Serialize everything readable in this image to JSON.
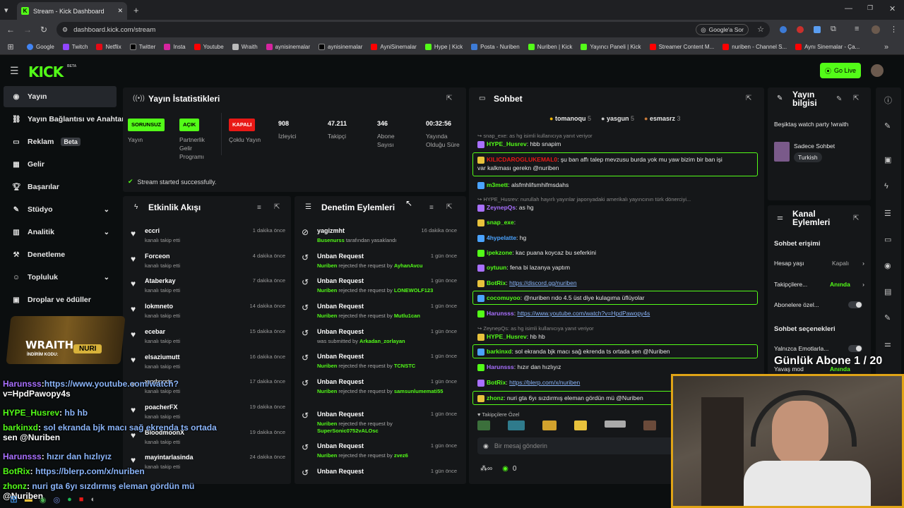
{
  "browser": {
    "tab_title": "Stream - Kick Dashboard",
    "url": "dashboard.kick.com/stream",
    "google_pill": "Google'a Sor",
    "bookmarks": [
      "Google",
      "Twitch",
      "Netflix",
      "Twitter",
      "Insta",
      "Youtube",
      "Wraith",
      "aynisinemalar",
      "aynisinemalar",
      "AyniSinemalar",
      "Hype | Kick",
      "Posta - Nuriben",
      "Nuriben | Kick",
      "Yayıncı Paneli | Kick",
      "Streamer Content M...",
      "nuriben - Channel S...",
      "Aynı Sinemalar - Ça..."
    ]
  },
  "header": {
    "logo": "KICK",
    "beta": "BETA",
    "go_live": "Go Live"
  },
  "sidebar": {
    "items": [
      {
        "label": "Yayın"
      },
      {
        "label": "Yayın Bağlantısı ve Anahtar"
      },
      {
        "label": "Reklam",
        "badge": "Beta"
      },
      {
        "label": "Gelir"
      },
      {
        "label": "Başarılar"
      },
      {
        "label": "Stüdyo"
      },
      {
        "label": "Analitik"
      },
      {
        "label": "Denetleme"
      },
      {
        "label": "Topluluk"
      },
      {
        "label": "Droplar ve ödüller"
      }
    ]
  },
  "stats": {
    "title": "Yayın İstatistikleri",
    "status_pills": [
      {
        "value": "SORUNSUZ",
        "label": "Yayın"
      },
      {
        "value": "AÇIK",
        "label": "Partnerlik Gelir Programı"
      },
      {
        "value": "KAPALI",
        "label": "Çoklu Yayın"
      }
    ],
    "numbers": [
      {
        "value": "908",
        "label": "İzleyici"
      },
      {
        "value": "47.211",
        "label": "Takipçi"
      },
      {
        "value": "346",
        "label": "Abone Sayısı"
      },
      {
        "value": "00:32:56",
        "label": "Yayında Olduğu Süre"
      }
    ],
    "success": "Stream started successfully.",
    "colors": {
      "ok": "#53fc18",
      "off": "#e91916"
    }
  },
  "activity": {
    "title": "Etkinlik Akışı",
    "rows": [
      {
        "name": "eccri",
        "sub": "kanalı takip etti",
        "time": "1 dakika önce"
      },
      {
        "name": "Forceon",
        "sub": "kanalı takip etti",
        "time": "4 dakika önce"
      },
      {
        "name": "Ataberkay",
        "sub": "kanalı takip etti",
        "time": "7 dakika önce"
      },
      {
        "name": "lokmneto",
        "sub": "kanalı takip etti",
        "time": "14 dakika önce"
      },
      {
        "name": "ecebar",
        "sub": "kanalı takip etti",
        "time": "15 dakika önce"
      },
      {
        "name": "elsaziumutt",
        "sub": "kanalı takip etti",
        "time": "16 dakika önce"
      },
      {
        "name": "xxxlxxxtr",
        "sub": "kanalı takip etti",
        "time": "17 dakika önce"
      },
      {
        "name": "poacherFX",
        "sub": "kanalı takip etti",
        "time": "19 dakika önce"
      },
      {
        "name": "BloodmoonX",
        "sub": "kanalı takip etti",
        "time": "19 dakika önce"
      },
      {
        "name": "mayintarlasinda",
        "sub": "kanalı takip etti",
        "time": "24 dakika önce"
      }
    ]
  },
  "moderation": {
    "title": "Denetim Eylemleri",
    "rows": [
      {
        "name": "yagizmht",
        "actor": "Busenurss",
        "text": " tarafından yasaklandı",
        "time": "16 dakika önce"
      },
      {
        "name": "Unban Request",
        "actor": "Nuriben",
        "text": " rejected the request by ",
        "target": "AyhanAvcu",
        "time": "1 gün önce"
      },
      {
        "name": "Unban Request",
        "actor": "Nuriben",
        "text": " rejected the request by ",
        "target": "LONEWOLF123",
        "time": "1 gün önce"
      },
      {
        "name": "Unban Request",
        "actor": "Nuriben",
        "text": " rejected the request by ",
        "target": "Mutlu1can",
        "time": "1 gün önce"
      },
      {
        "name": "Unban Request",
        "actor": "",
        "text": "was submitted by ",
        "target": "Arkadan_zorlayan",
        "time": "1 gün önce"
      },
      {
        "name": "Unban Request",
        "actor": "Nuriben",
        "text": " rejected the request by ",
        "target": "TCNSTC",
        "time": "1 gün önce"
      },
      {
        "name": "Unban Request",
        "actor": "Nuriben",
        "text": " rejected the request by ",
        "target": "samsunlumemati55",
        "time": "1 gün önce"
      },
      {
        "name": "Unban Request",
        "actor": "Nuriben",
        "text": " rejected the request by ",
        "target": "SuperSonic0752vALOsc",
        "time": "1 gün önce"
      },
      {
        "name": "Unban Request",
        "actor": "Nuriben",
        "text": " rejected the request by ",
        "target": "zvez6",
        "time": "1 gün önce"
      },
      {
        "name": "Unban Request",
        "actor": "",
        "text": "",
        "target": "",
        "time": "1 gün önce"
      }
    ]
  },
  "chat": {
    "title": "Sohbet",
    "top_gifters": [
      {
        "name": "tomanoqu",
        "count": "5"
      },
      {
        "name": "yasgun",
        "count": "5"
      },
      {
        "name": "esmasrz",
        "count": "3"
      }
    ],
    "messages": [
      {
        "reply": "snap_exe: as hg isimli kullanıcıya yanıt veriyor"
      },
      {
        "user": "HYPE_Husrev",
        "color": "#53fc18",
        "text": "hbb snapim"
      },
      {
        "user": "KILICDAROGLUKEMAL0",
        "color": "#e91916",
        "text": "şu ban affı talep mevzusu burda yok mu yaw bizim bir ban işi",
        "text2": "var kalkması gerekn @nuriben",
        "highlight": true
      },
      {
        "user": "m3mett",
        "color": "#53fc18",
        "text": "alsfmhlifsmhifmsdahs"
      },
      {
        "reply": "HYPE_Husrev: nurullah hayırlı yayınlar japonyadaki amerikalı yayıncının türk dönerciyi..."
      },
      {
        "user": "ZeynepQs",
        "color": "#a970ff",
        "text": "as hg"
      },
      {
        "user": "snap_exe",
        "color": "#53fc18",
        "text": ""
      },
      {
        "user": "4hypelatte",
        "color": "#4aa3ff",
        "text": "hg"
      },
      {
        "user": "ipekzone",
        "color": "#53fc18",
        "text": "kac puana koycaz bu seferkini"
      },
      {
        "user": "oytuun",
        "color": "#53fc18",
        "text": "fena bi lazanya yaptım"
      },
      {
        "user": "BotRix",
        "color": "#53fc18",
        "link": "https://discord.gg/nuriben"
      },
      {
        "user": "cocomuyoo",
        "color": "#53fc18",
        "text": "@nuriben rıdo 4.5 üst diye kulagıma üflüyolar",
        "highlight": true
      },
      {
        "user": "Harunsss",
        "color": "#a970ff",
        "link": "https://www.youtube.com/watch?v=HpdPawopy4s"
      },
      {
        "reply": "ZeynepQs: as hg isimli kullanıcıya yanıt veriyor"
      },
      {
        "user": "HYPE_Husrev",
        "color": "#53fc18",
        "text": "hb hb"
      },
      {
        "user": "barkinxd",
        "color": "#53fc18",
        "text": "sol ekranda bjk macı sağ ekrenda ts ortada sen @Nuriben",
        "highlight": true
      },
      {
        "user": "Harunsss",
        "color": "#a970ff",
        "text": "hızır dan hızlıyız"
      },
      {
        "user": "BotRix",
        "color": "#53fc18",
        "link": "https://blerp.com/x/nuriben"
      },
      {
        "user": "zhonz",
        "color": "#53fc18",
        "text": "nuri gta 6yı sızdırmış eleman gördün mü @Nuriben",
        "highlight": true
      }
    ],
    "followers_label": "Takipçilere Özel",
    "input_placeholder": "Bir mesaj gönderin",
    "points": "0"
  },
  "stream_info": {
    "title": "Yayın bilgisi",
    "stream_title": "Beşiktaş watch party !wraith",
    "category": "Sadece Sohbet",
    "language": "Turkish"
  },
  "channel_actions": {
    "title": "Kanal Eylemleri",
    "chat_access": "Sohbet erişimi",
    "rows": [
      {
        "label": "Hesap yaşı",
        "value": "Kapalı"
      },
      {
        "label": "Takipçilere...",
        "value": "Anında"
      },
      {
        "label": "Abonelere özel..."
      }
    ],
    "chat_options": "Sohbet seçenekleri",
    "rows2": [
      {
        "label": "Yalnızca Emotlarla..."
      },
      {
        "label": "Yavaş mod",
        "value": "Anında"
      }
    ]
  },
  "overlay": {
    "wraith_logo": "WRAITH.",
    "wraith_code_label": "İNDİRİM KODU:",
    "wraith_code": "NURI",
    "sub_goal": "Günlük Abone 1 / 20",
    "chat": [
      {
        "user": "Harunsss",
        "text": "https://www.youtube.com/watch?",
        "text2": "v=HpdPawopy4s"
      },
      {
        "user": "HYPE_Husrev",
        "text": " hb hb"
      },
      {
        "user": "barkinxd",
        "text": " sol ekranda bjk macı sağ ekrenda ts ortada",
        "text2": "sen @Nuriben"
      },
      {
        "user": "Harunsss",
        "text": " hızır dan hızlıyız"
      },
      {
        "user": "BotRix",
        "text": " https://blerp.com/x/nuriben"
      },
      {
        "user": "zhonz",
        "text": " nuri gta 6yı sızdırmış eleman gördün mü",
        "text2": "@Nuriben"
      }
    ]
  }
}
